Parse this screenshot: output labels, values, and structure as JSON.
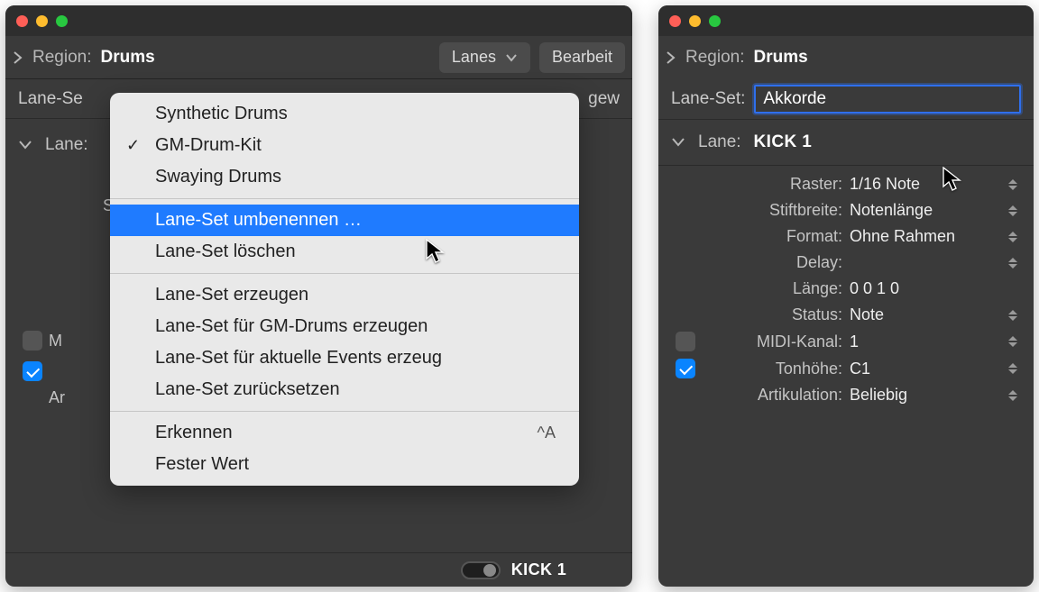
{
  "left": {
    "region_label": "Region:",
    "region_value": "Drums",
    "lanes_button": "Lanes",
    "edit_button": "Bearbeit",
    "lane_set_label_short": "Lane-Se",
    "extra_label_right": "gew",
    "lane_row_label": "Lane:",
    "mute_row_label_fragment": "M",
    "art_row_label_fragment": "Ar",
    "s_row_label_fragment": "S",
    "kick_label": "KICK 1"
  },
  "menu": {
    "heading_items": [
      "Synthetic Drums",
      "GM-Drum-Kit",
      "Swaying Drums"
    ],
    "checked_index": 1,
    "group2": [
      "Lane-Set umbenennen …",
      "Lane-Set löschen"
    ],
    "highlight_key": "group2.0",
    "group3": [
      "Lane-Set erzeugen",
      "Lane-Set für GM-Drums erzeugen",
      "Lane-Set für aktuelle Events erzeug",
      "Lane-Set zurücksetzen"
    ],
    "group4": [
      {
        "label": "Erkennen",
        "shortcut": "^A"
      },
      {
        "label": "Fester Wert",
        "shortcut": ""
      }
    ]
  },
  "right": {
    "region_label": "Region:",
    "region_value": "Drums",
    "lane_set_label": "Lane-Set:",
    "lane_set_value": "Akkorde",
    "lane_label": "Lane:",
    "lane_value": "KICK 1",
    "rows": [
      {
        "label": "Raster:",
        "value": "1/16 Note",
        "checkbox": null,
        "stepper": true
      },
      {
        "label": "Stiftbreite:",
        "value": "Notenlänge",
        "checkbox": null,
        "stepper": true
      },
      {
        "label": "Format:",
        "value": "Ohne Rahmen",
        "checkbox": null,
        "stepper": true
      },
      {
        "label": "Delay:",
        "value": "",
        "checkbox": null,
        "stepper": true
      },
      {
        "label": "Länge:",
        "value": "0  0  1     0",
        "checkbox": null,
        "stepper": false
      },
      {
        "label": "Status:",
        "value": "Note",
        "checkbox": null,
        "stepper": true
      },
      {
        "label": "MIDI-Kanal:",
        "value": "1",
        "checkbox": false,
        "stepper": true
      },
      {
        "label": "Tonhöhe:",
        "value": "C1",
        "checkbox": true,
        "stepper": true
      },
      {
        "label": "Artikulation:",
        "value": "Beliebig",
        "checkbox": null,
        "stepper": true
      }
    ]
  }
}
